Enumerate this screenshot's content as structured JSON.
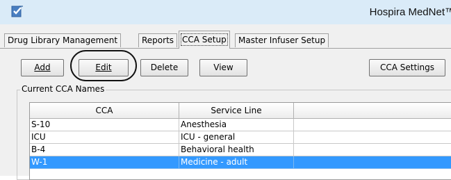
{
  "window": {
    "title": "Hospira MedNet™"
  },
  "tabs": [
    {
      "label": "Drug Library Management",
      "active": false
    },
    {
      "label": "Reports",
      "active": false
    },
    {
      "label": "CCA Setup",
      "active": true
    },
    {
      "label": "Master Infuser Setup",
      "active": false
    }
  ],
  "toolbar": {
    "add_label": "Add",
    "edit_label": "Edit",
    "delete_label": "Delete",
    "view_label": "View",
    "cca_settings_label": "CCA Settings"
  },
  "group": {
    "label": "Current CCA Names"
  },
  "table": {
    "columns": [
      "CCA",
      "Service Line",
      ""
    ],
    "rows": [
      {
        "cca": "S-10",
        "service_line": "Anesthesia",
        "selected": false
      },
      {
        "cca": "ICU",
        "service_line": "ICU - general",
        "selected": false
      },
      {
        "cca": "B-4",
        "service_line": "Behavioral health",
        "selected": false
      },
      {
        "cca": "W-1",
        "service_line": "Medicine - adult",
        "selected": true
      }
    ]
  },
  "colors": {
    "titlebar": "#daebf8",
    "selection": "#3399ff",
    "logo": "#4a7fc1"
  },
  "icons": {
    "app_logo": "checklist-logo-icon"
  }
}
